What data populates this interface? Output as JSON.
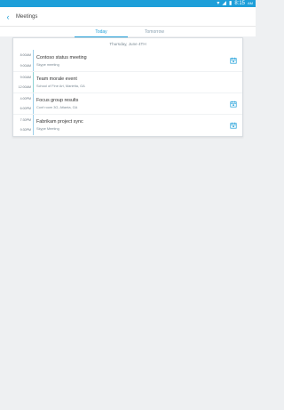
{
  "status_bar": {
    "time": "8:15",
    "am_pm": "AM"
  },
  "app_bar": {
    "title": "Meetings"
  },
  "tabs": [
    {
      "label": "Today",
      "active": true
    },
    {
      "label": "Tomorrow",
      "active": false
    }
  ],
  "day_header": "Thursday, June 4TH",
  "events": [
    {
      "start": "8:00AM",
      "end": "9:00AM",
      "title": "Contoso status meeting",
      "subtitle": "Skype meeting",
      "has_calendar_icon": true
    },
    {
      "start": "9:00AM",
      "end": "12:00AM",
      "title": "Team morale event",
      "subtitle": "School of Fine Art, Marietta, GA",
      "has_calendar_icon": false
    },
    {
      "start": "4:00PM",
      "end": "6:00PM",
      "title": "Focus group results",
      "subtitle": "Conf room 3G, Atlanta, GA",
      "has_calendar_icon": true
    },
    {
      "start": "7:30PM",
      "end": "9:30PM",
      "title": "Fabrikam project sync",
      "subtitle": "Skype Meeting",
      "has_calendar_icon": true
    }
  ],
  "colors": {
    "accent": "#1e9fd9",
    "background": "#eef0f2"
  }
}
